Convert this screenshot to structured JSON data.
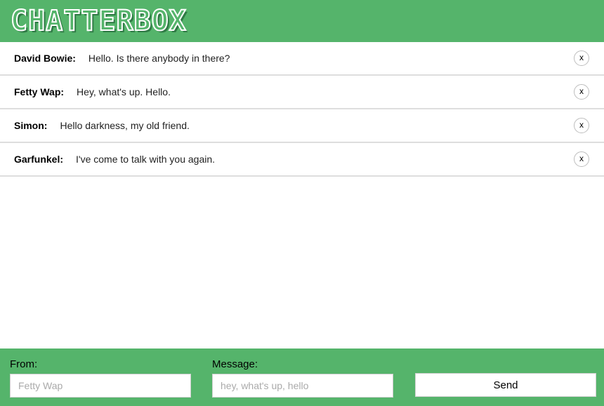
{
  "header": {
    "logo_text": "CHATTERBOX"
  },
  "messages": [
    {
      "author": "David Bowie:",
      "text": "Hello. Is there anybody in there?",
      "delete_label": "x"
    },
    {
      "author": "Fetty Wap:",
      "text": "Hey, what's up. Hello.",
      "delete_label": "x"
    },
    {
      "author": "Simon:",
      "text": "Hello darkness, my old friend.",
      "delete_label": "x"
    },
    {
      "author": "Garfunkel:",
      "text": "I've come to talk with you again.",
      "delete_label": "x"
    }
  ],
  "form": {
    "from_label": "From:",
    "from_placeholder": "Fetty Wap",
    "message_label": "Message:",
    "message_placeholder": "hey, what's up, hello",
    "send_label": "Send"
  },
  "colors": {
    "accent": "#55b46b",
    "divider": "#dedede"
  }
}
